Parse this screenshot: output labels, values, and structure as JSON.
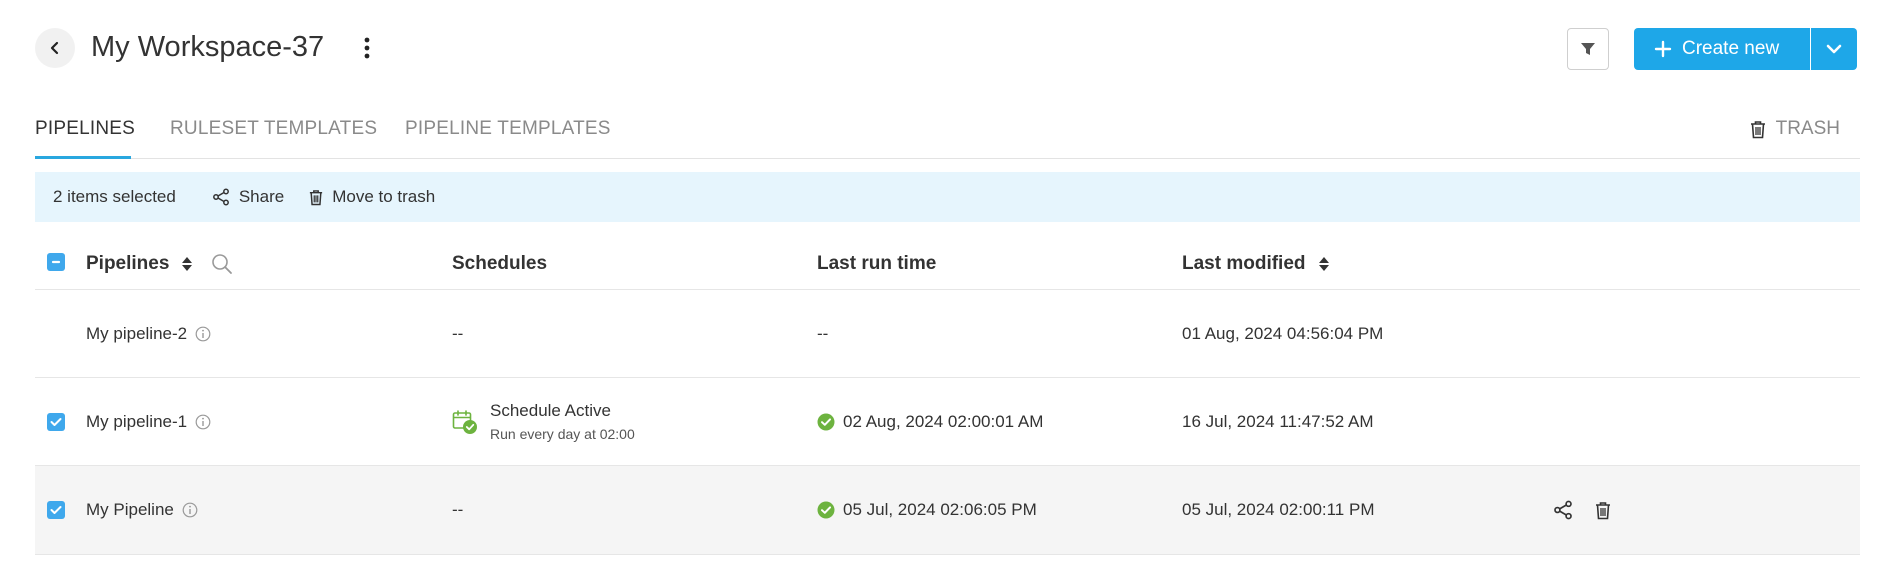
{
  "header": {
    "title": "My Workspace-37",
    "create_label": "Create new"
  },
  "tabs": [
    {
      "label": "PIPELINES",
      "active": true
    },
    {
      "label": "RULESET TEMPLATES",
      "active": false
    },
    {
      "label": "PIPELINE TEMPLATES",
      "active": false
    }
  ],
  "trash_label": "TRASH",
  "selection_bar": {
    "count_text": "2 items selected",
    "share_label": "Share",
    "trash_label": "Move to trash"
  },
  "columns": {
    "pipelines": "Pipelines",
    "schedules": "Schedules",
    "last_run": "Last run time",
    "last_modified": "Last modified"
  },
  "rows": [
    {
      "name": "My pipeline-2",
      "schedule": "--",
      "last_run": "--",
      "last_modified": "01 Aug, 2024 04:56:04 PM",
      "checked": false
    },
    {
      "name": "My pipeline-1",
      "schedule_title": "Schedule Active",
      "schedule_sub": "Run every day at 02:00",
      "last_run": "02 Aug, 2024 02:00:01 AM",
      "last_modified": "16 Jul, 2024 11:47:52 AM",
      "checked": true
    },
    {
      "name": "My Pipeline",
      "schedule": "--",
      "last_run": "05 Jul, 2024 02:06:05 PM",
      "last_modified": "05 Jul, 2024 02:00:11 PM",
      "checked": true
    }
  ],
  "colors": {
    "accent": "#1ea7e8",
    "success": "#6db33f",
    "selection_bg": "#e6f5fd"
  }
}
